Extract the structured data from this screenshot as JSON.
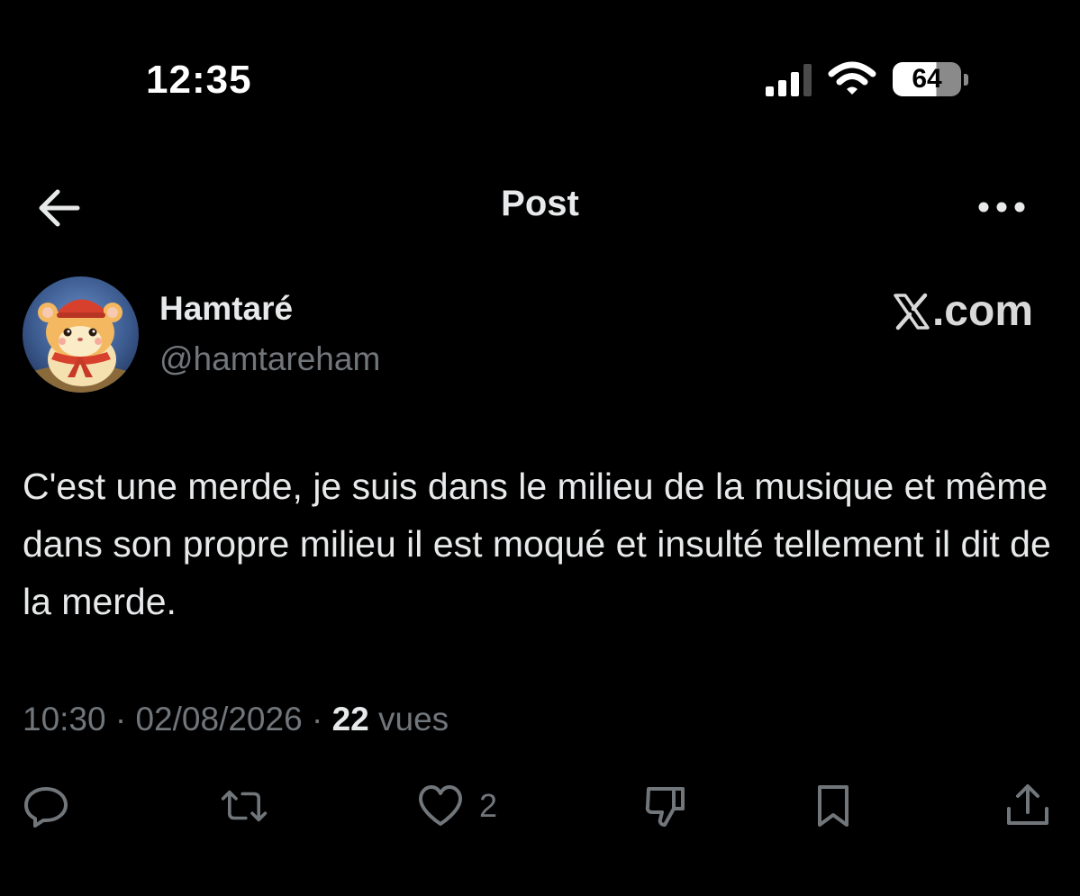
{
  "status_bar": {
    "time": "12:35",
    "battery_level": "64"
  },
  "header": {
    "title": "Post"
  },
  "author": {
    "display_name": "Hamtaré",
    "handle": "@hamtareham"
  },
  "watermark": {
    "text": ".com",
    "logo": "x-logo"
  },
  "tweet": {
    "text": "C'est une merde, je suis dans le milieu de la musique et même dans son propre milieu il est moqué et insulté tellement il dit de la merde.",
    "time": "10:30",
    "date": "02/08/2026",
    "separator": "·",
    "views_count": "22",
    "views_label": "vues"
  },
  "actions": {
    "like_count": "2"
  },
  "colors": {
    "background": "#000000",
    "text_primary": "#e7e9ea",
    "text_secondary": "#71767b"
  }
}
